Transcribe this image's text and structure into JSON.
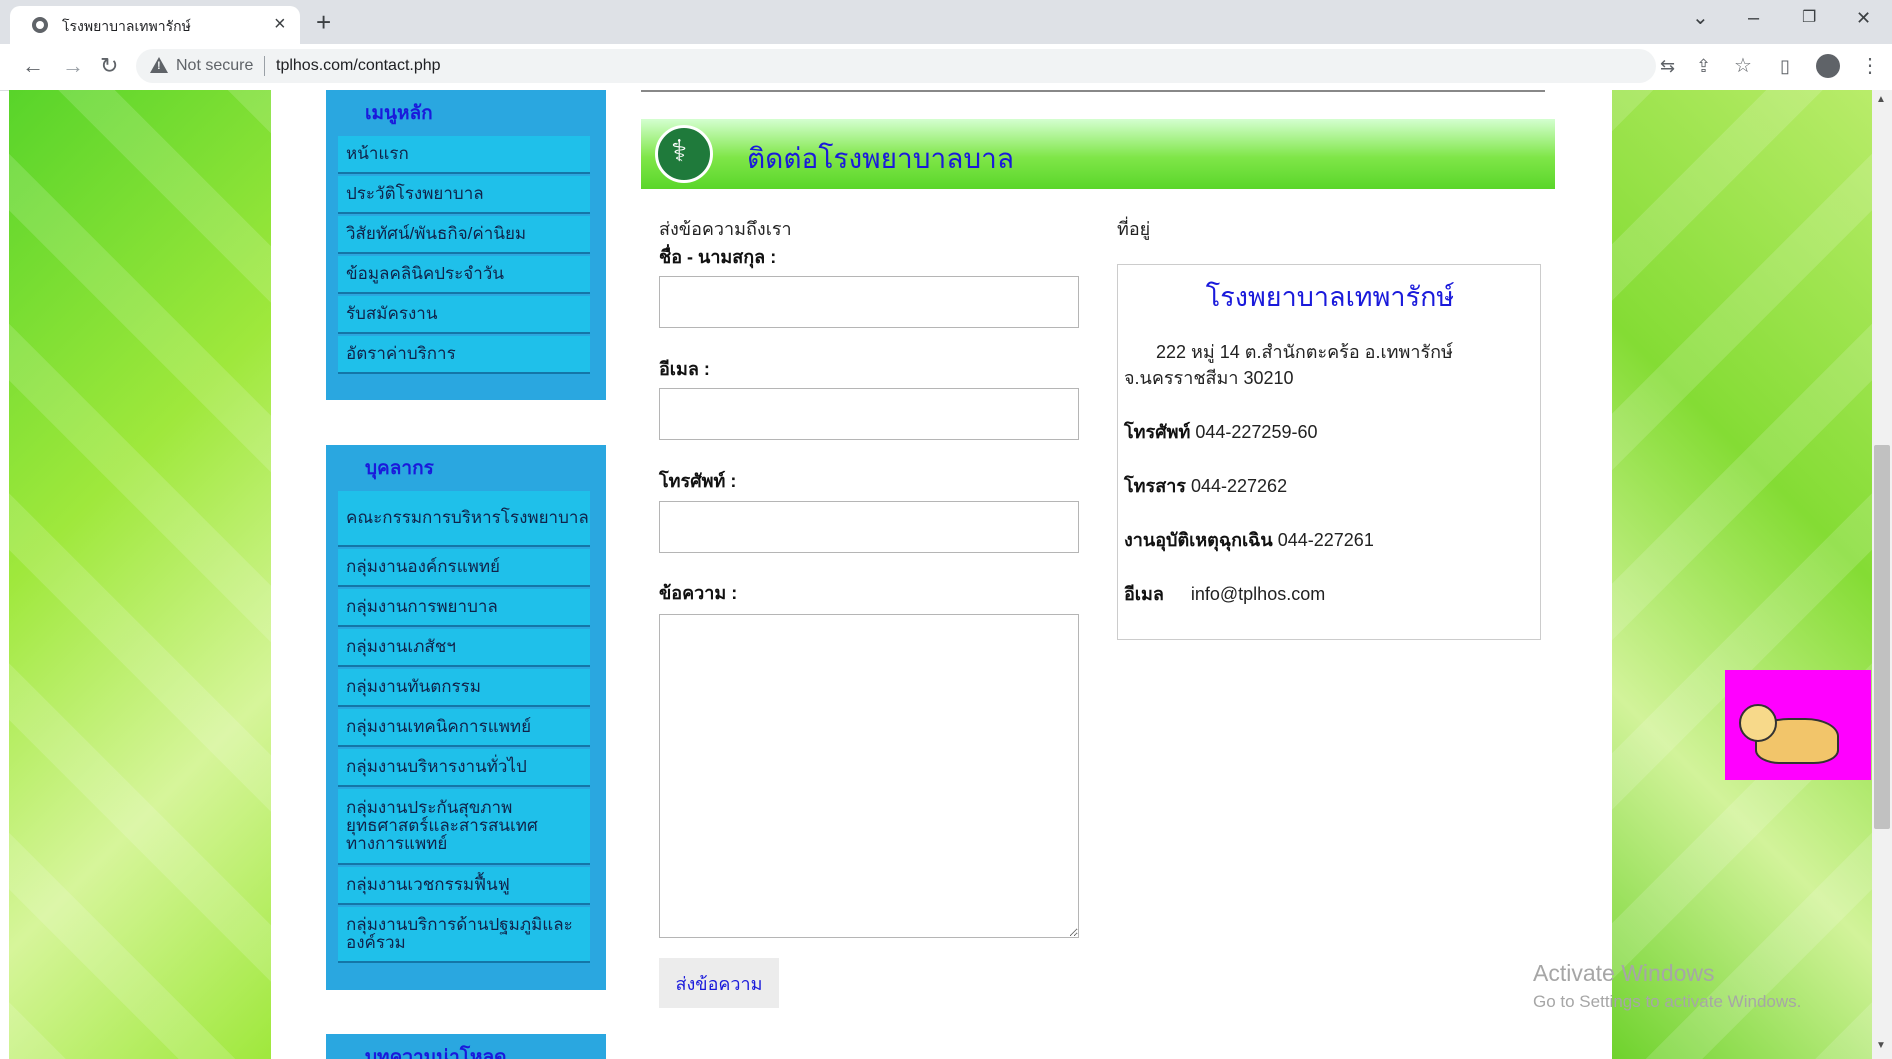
{
  "browser": {
    "tab_title": "โรงพยาบาลเทพารักษ์",
    "tab_close": "×",
    "new_tab": "+",
    "security_label": "Not secure",
    "url": "tplhos.com/contact.php",
    "window_controls": {
      "dropdown": "⌄",
      "minimize": "–",
      "maximize": "❐",
      "close": "✕"
    },
    "nav": {
      "back": "←",
      "forward": "→",
      "reload": "↻"
    },
    "toolbar_icons": {
      "translate": "⇆",
      "share": "⇪",
      "star": "☆",
      "sidepanel": "▯",
      "menu": "⋮"
    }
  },
  "sidebar": {
    "main_menu": {
      "title": "เมนูหลัก",
      "items": [
        "หน้าแรก",
        "ประวัติโรงพยาบาล",
        "วิสัยทัศน์/พันธกิจ/ค่านิยม",
        "ข้อมูลคลินิคประจำวัน",
        "รับสมัครงาน",
        "อัตราค่าบริการ"
      ]
    },
    "personnel": {
      "title": "บุคลากร",
      "items": [
        "คณะกรรมการบริหารโรงพยาบาล",
        "กลุ่มงานองค์กรแพทย์",
        "กลุ่มงานการพยาบาล",
        "กลุ่มงานเภสัชฯ",
        "กลุ่มงานทันตกรรม",
        "กลุ่มงานเทคนิคการแพทย์",
        "กลุ่มงานบริหารงานทั่วไป",
        "กลุ่มงานประกันสุขภาพ ยุทธศาสตร์และสารสนเทศทางการแพทย์",
        "กลุ่มงานเวชกรรมฟื้นฟู",
        "กลุ่มงานบริการด้านปฐมภูมิและองค์รวม"
      ]
    },
    "downloads": {
      "title": "บทความน่าโหลด"
    }
  },
  "main": {
    "header_title": "ติดต่อโรงพยาบาลบาล",
    "form": {
      "intro": "ส่งข้อความถึงเรา",
      "name_label": "ชื่อ - นามสกุล :",
      "email_label": "อีเมล :",
      "phone_label": "โทรศัพท์ :",
      "message_label": "ข้อความ :",
      "submit_label": "ส่งข้อความ",
      "name_value": "",
      "email_value": "",
      "phone_value": "",
      "message_value": ""
    },
    "address": {
      "heading": "ที่อยู่",
      "hospital_name": "โรงพยาบาลเทพารักษ์",
      "address_line1": "222 หมู่ 14 ต.สำนักตะคร้อ อ.เทพารักษ์",
      "address_line2": "จ.นครราชสีมา 30210",
      "phone_label": "โทรศัพท์",
      "phone_value": "044-227259-60",
      "fax_label": "โทรสาร",
      "fax_value": "044-227262",
      "emergency_label": "งานอุบัติเหตุฉุกเฉิน",
      "emergency_value": "044-227261",
      "email_label": "อีเมล",
      "email_value": "info@tplhos.com"
    }
  },
  "overlay": {
    "activate_title": "Activate Windows",
    "activate_sub": "Go to Settings to activate Windows."
  },
  "colors": {
    "menu_box": "#2aa7e0",
    "menu_item": "#1fc0ea",
    "link_blue": "#1a1adb",
    "header_green": "#7fe648",
    "widget_magenta": "#ff00ff"
  }
}
